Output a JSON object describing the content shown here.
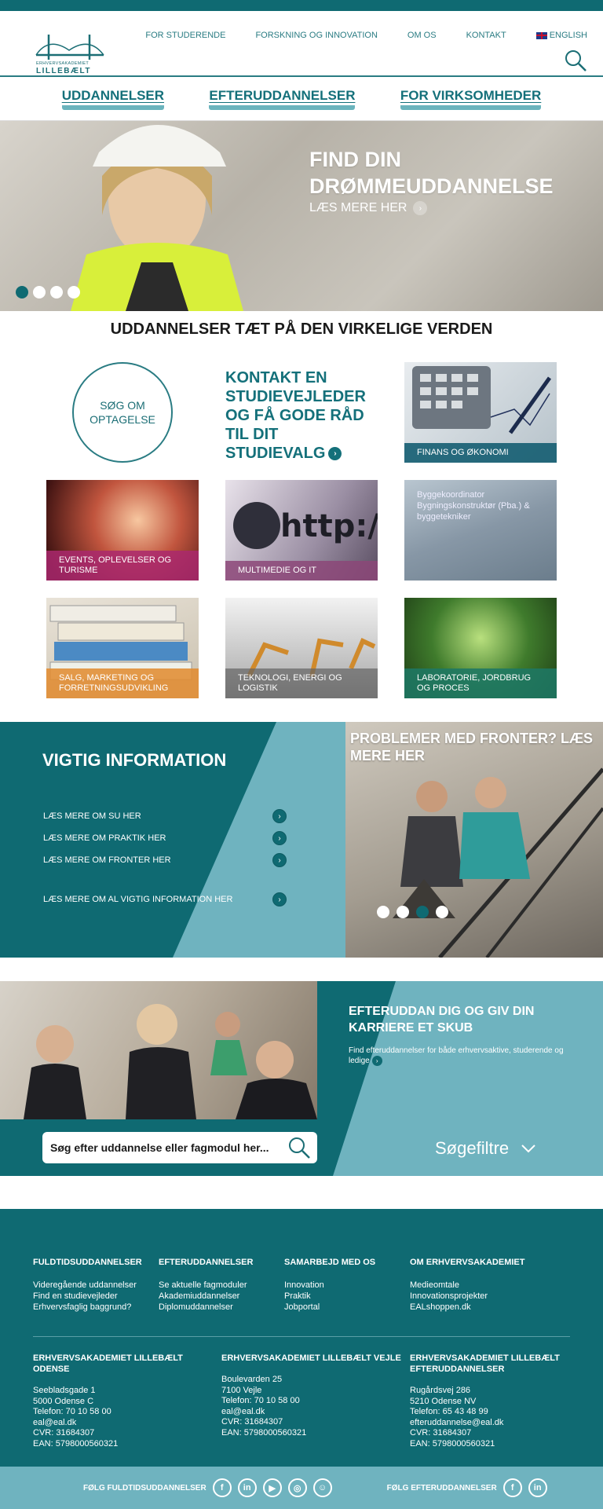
{
  "brand": {
    "logo_subtext": "ERHVERVSAKADEMIET",
    "logo_name": "LILLEBÆLT",
    "colors": {
      "primary": "#0f6a72",
      "light": "#6fb3bf"
    }
  },
  "topnav": {
    "items": [
      "FOR STUDERENDE",
      "FORSKNING OG INNOVATION",
      "OM OS",
      "KONTAKT"
    ],
    "lang": "ENGLISH"
  },
  "mainnav": [
    "UDDANNELSER",
    "EFTERUDDANNELSER",
    "FOR VIRKSOMHEDER"
  ],
  "hero": {
    "title": "FIND DIN DRØMMEUDDANNELSE",
    "more": "LÆS MERE HER",
    "slides": 4,
    "active_slide": 1
  },
  "section_title": "UDDANNELSER TÆT PÅ DEN VIRKELIGE VERDEN",
  "tiles": {
    "apply": "SØG OM OPTAGELSE",
    "contact": "KONTAKT EN STUDIEVEJLEDER OG FÅ GODE RÅD TIL DIT STUDIEVALG",
    "finans": "FINANS OG ØKONOMI",
    "events": "EVENTS, OPLEVELSER OG TURISME",
    "multimedie": "MULTIMEDIE OG IT",
    "bygge": "Byggekoordinator Bygningskonstruktør (Pba.) & byggetekniker",
    "salg": "SALG, MARKETING OG FORRETNINGSUDVIKLING",
    "teknologi": "TEKNOLOGI, ENERGI OG LOGISTIK",
    "lab": "LABORATORIE, JORDBRUG OG PROCES"
  },
  "vigtig": {
    "title": "VIGTIG INFORMATION",
    "links": [
      "LÆS MERE OM SU HER",
      "LÆS MERE OM PRAKTIK HER",
      "LÆS MERE OM FRONTER HER",
      "LÆS MERE OM AL VIGTIG INFORMATION HER"
    ],
    "side_title": "PROBLEMER MED FRONTER? LÆS MERE HER",
    "slides": 4,
    "active_slide": 3
  },
  "efteruddannelse": {
    "title": "EFTERUDDAN DIG OG GIV DIN KARRIERE ET SKUB",
    "text": "Find efteruddannelser for både erhvervsaktive, studerende og ledige",
    "search_placeholder": "Søg efter uddannelse eller fagmodul her...",
    "filter": "Søgefiltre"
  },
  "footer": {
    "cols": [
      {
        "title": "FULDTIDSUDDANNELSER",
        "items": [
          "Videregående uddannelser",
          "Find en studievejleder",
          "Erhvervsfaglig baggrund?"
        ]
      },
      {
        "title": "EFTERUDDANNELSER",
        "items": [
          "Se aktuelle fagmoduler",
          "Akademiuddannelser",
          "Diplomuddannelser"
        ]
      },
      {
        "title": "SAMARBEJD MED OS",
        "items": [
          "Innovation",
          "Praktik",
          "Jobportal"
        ]
      },
      {
        "title": "OM ERHVERVSAKADEMIET",
        "items": [
          "Medieomtale",
          "Innovationsprojekter",
          "EALshoppen.dk"
        ]
      }
    ],
    "addresses": [
      {
        "title": "ERHVERVSAKADEMIET LILLEBÆLT ODENSE",
        "lines": [
          "Seebladsgade 1",
          "5000 Odense C",
          "Telefon: 70 10 58 00",
          "eal@eal.dk",
          "CVR: 31684307",
          "EAN: 5798000560321"
        ]
      },
      {
        "title": "ERHVERVSAKADEMIET LILLEBÆLT VEJLE",
        "lines": [
          "Boulevarden 25",
          "7100 Vejle",
          "Telefon: 70 10 58 00",
          "eal@eal.dk",
          "CVR: 31684307",
          "EAN: 5798000560321"
        ]
      },
      {
        "title": "ERHVERVSAKADEMIET LILLEBÆLT EFTERUDDANNELSER",
        "lines": [
          "Rugårdsvej 286",
          "5210 Odense NV",
          "Telefon: 65 43 48 99",
          "efteruddannelse@eal.dk",
          "CVR: 31684307",
          "EAN: 5798000560321"
        ]
      }
    ],
    "follow_full": "FØLG FULDTIDSUDDANNELSER",
    "follow_eft": "FØLG EFTERUDDANNELSER"
  }
}
